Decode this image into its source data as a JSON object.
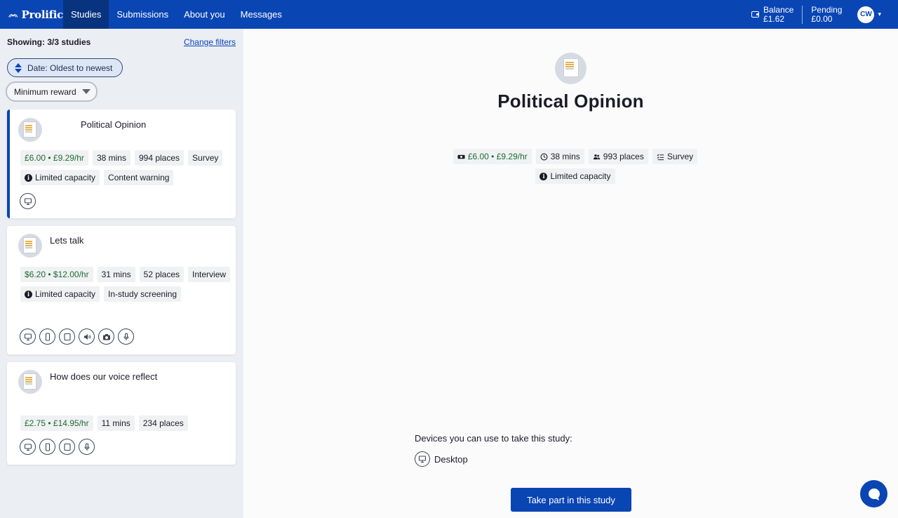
{
  "nav": {
    "brand": "Prolific",
    "items": [
      {
        "label": "Studies",
        "active": true
      },
      {
        "label": "Submissions",
        "active": false
      },
      {
        "label": "About you",
        "active": false
      },
      {
        "label": "Messages",
        "active": false
      }
    ],
    "balance_label": "Balance",
    "balance_value": "£1.62",
    "pending_label": "Pending",
    "pending_value": "£0.00",
    "avatar_initials": "CW"
  },
  "sidebar": {
    "showing": "Showing: 3/3 studies",
    "change_filters": "Change filters",
    "sort_label": "Date: Oldest to newest",
    "reward_filter": "Minimum reward",
    "studies": [
      {
        "title": "Political Opinion",
        "tags_row1": [
          "£6.00 • £9.29/hr",
          "38 mins",
          "994 places",
          "Survey"
        ],
        "limited": "Limited capacity",
        "warning": "Content warning",
        "devices": [
          "desktop-icon"
        ]
      },
      {
        "title": "Lets talk",
        "tags_row1": [
          "$6.20 • $12.00/hr",
          "31 mins",
          "52 places"
        ],
        "interview": "Interview",
        "limited": "Limited capacity",
        "screening": "In-study screening",
        "devices": [
          "desktop-icon",
          "mobile-icon",
          "tablet-icon",
          "speaker-icon",
          "camera-icon",
          "microphone-icon"
        ]
      },
      {
        "title": "How does our voice reflect",
        "tags_row1": [
          "£2.75 • £14.95/hr",
          "11 mins",
          "234 places"
        ],
        "devices": [
          "desktop-icon",
          "mobile-icon",
          "tablet-icon",
          "microphone-icon"
        ]
      }
    ]
  },
  "main": {
    "title": "Political Opinion",
    "reward": "£6.00 • £9.29/hr",
    "duration": "38 mins",
    "places": "993 places",
    "type": "Survey",
    "limited": "Limited capacity",
    "devices_label": "Devices you can use to take this study:",
    "device": "Desktop",
    "cta": "Take part in this study"
  },
  "colors": {
    "brand": "#0a45b4",
    "money": "#1d6b34"
  }
}
